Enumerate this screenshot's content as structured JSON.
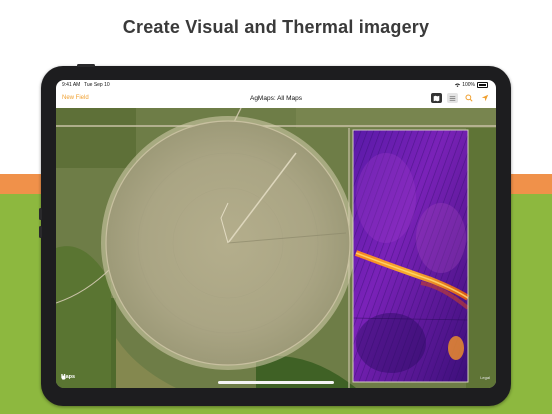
{
  "headline": "Create Visual and Thermal imagery",
  "status_bar": {
    "time": "9:41 AM",
    "date": "Tue Sep 10",
    "battery": "100%"
  },
  "nav": {
    "left_button": "New Field",
    "title": "AgMaps: All Maps",
    "icons": [
      "map-icon",
      "list-icon",
      "search-icon",
      "location-arrow-icon"
    ]
  },
  "map": {
    "brand": "Maps",
    "legal": "Legal",
    "thermal_overlay": true
  },
  "colors": {
    "accent": "#f0a030",
    "band_orange": "#f0914a",
    "band_green": "#8db83f"
  }
}
